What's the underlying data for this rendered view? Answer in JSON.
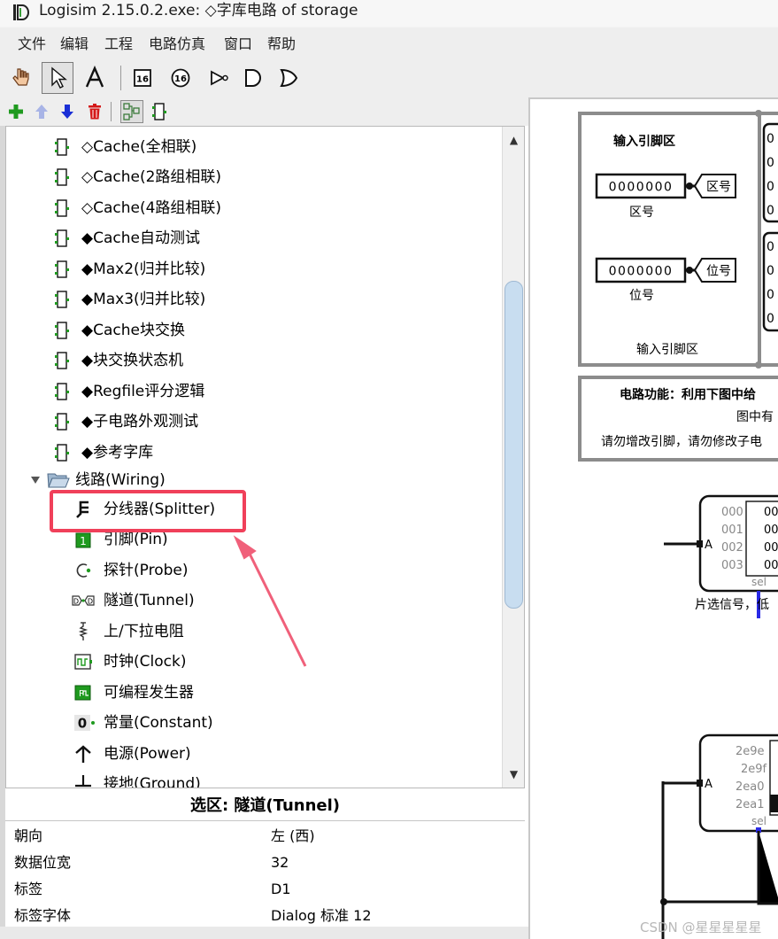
{
  "window": {
    "title": "Logisim 2.15.0.2.exe: ◇字库电路 of storage"
  },
  "menu": [
    "文件",
    "编辑",
    "工程",
    "电路仿真",
    "窗口",
    "帮助"
  ],
  "toolbar": {
    "tools": [
      "poke-tool-icon",
      "select-tool-icon",
      "text-tool-icon",
      "pin-tool-icon",
      "output-pin-tool-icon",
      "not-gate-icon",
      "and-gate-icon",
      "or-gate-icon"
    ],
    "selected": "select-tool-icon",
    "project_tools": [
      "add-circuit-icon",
      "move-up-icon",
      "move-down-icon",
      "delete-circuit-icon",
      "layout-view-icon",
      "appearance-view-icon"
    ]
  },
  "explorer": {
    "circuits": [
      "◇Cache(全相联)",
      "◇Cache(2路组相联)",
      "◇Cache(4路组相联)",
      "◆Cache自动测试",
      "◆Max2(归并比较)",
      "◆Max3(归并比较)",
      "◆Cache块交换",
      "◆块交换状态机",
      "◆Regfile评分逻辑",
      "◆子电路外观测试",
      "◆参考字库"
    ],
    "folder": "线路(Wiring)",
    "wiring_items": [
      {
        "label": "分线器(Splitter)",
        "icon": "splitter-icon"
      },
      {
        "label": "引脚(Pin)",
        "icon": "pin-icon"
      },
      {
        "label": "探针(Probe)",
        "icon": "probe-icon"
      },
      {
        "label": "隧道(Tunnel)",
        "icon": "tunnel-icon"
      },
      {
        "label": "上/下拉电阻",
        "icon": "pull-resistor-icon"
      },
      {
        "label": "时钟(Clock)",
        "icon": "clock-icon"
      },
      {
        "label": "可编程发生器",
        "icon": "programmable-generator-icon"
      },
      {
        "label": "常量(Constant)",
        "icon": "constant-icon"
      },
      {
        "label": "电源(Power)",
        "icon": "power-icon"
      },
      {
        "label": "接地(Ground)",
        "icon": "ground-icon"
      }
    ],
    "highlighted": "分线器(Splitter)"
  },
  "attributes": {
    "title": "选区: 隧道(Tunnel)",
    "rows": [
      {
        "key": "朝向",
        "value": "左 (西)"
      },
      {
        "key": "数据位宽",
        "value": "32"
      },
      {
        "key": "标签",
        "value": "D1"
      },
      {
        "key": "标签字体",
        "value": "Dialog 标准 12"
      }
    ]
  },
  "canvas": {
    "input_area_title": "输入引脚区",
    "input_area_footer": "输入引脚区",
    "pins": [
      {
        "value": "0000000",
        "tunnel": "区号",
        "caption": "区号"
      },
      {
        "value": "0000000",
        "tunnel": "位号",
        "caption": "位号"
      }
    ],
    "right_digits": [
      "0",
      "0",
      "0",
      "0",
      "0",
      "0",
      "0",
      "0"
    ],
    "desc_lines": [
      "电路功能：利用下图中给",
      "图中有",
      "请勿增改引脚，请勿修改子电"
    ],
    "rom1": {
      "addrs": [
        "000",
        "001",
        "002",
        "003"
      ],
      "data": [
        "00",
        "00",
        "00",
        "00"
      ],
      "port": "A",
      "sel": "sel"
    },
    "chip_select_caption": "片选信号，低",
    "rom2": {
      "addrs": [
        "2e9e",
        "2e9f",
        "2ea0",
        "2ea1"
      ],
      "port": "A",
      "sel": "sel"
    }
  },
  "watermark": "CSDN @星星星星星",
  "colors": {
    "highlight": "#f0405a",
    "arrow": "#f0607a",
    "icon_green": "#1f9a1f",
    "blue_wire": "#2a2ae6"
  }
}
